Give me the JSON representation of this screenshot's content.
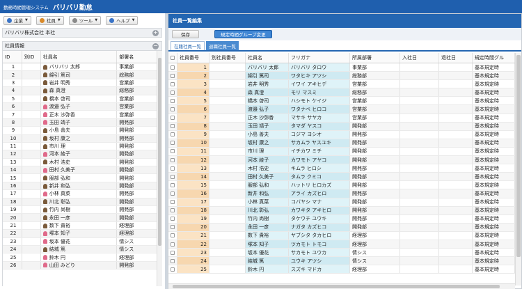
{
  "app": {
    "system_name": "勤務時間管理システム",
    "app_name": "バリバリ勤怠"
  },
  "menu": [
    {
      "label": "企業",
      "icon": "building-icon",
      "color": "#3a74c7"
    },
    {
      "label": "社員",
      "icon": "employees-icon",
      "color": "#d98a2b"
    },
    {
      "label": "ツール",
      "icon": "gear-icon",
      "color": "#8a8a8a"
    },
    {
      "label": "ヘルプ",
      "icon": "help-icon",
      "color": "#3a74c7"
    }
  ],
  "left": {
    "company": "バリバリ株式会社 本社",
    "section_title": "社員情報",
    "columns": [
      "ID",
      "別ID",
      "社員名",
      "部署名"
    ],
    "rows": [
      {
        "id": "1",
        "alt_id": "",
        "name": "バリバリ 太郎",
        "dept": "事業部",
        "g": "m"
      },
      {
        "id": "2",
        "alt_id": "",
        "name": "綿引 篤司",
        "dept": "総務部",
        "g": "m"
      },
      {
        "id": "3",
        "alt_id": "",
        "name": "岩井 明秀",
        "dept": "営業部",
        "g": "m"
      },
      {
        "id": "4",
        "alt_id": "",
        "name": "森 真澄",
        "dept": "総務部",
        "g": "m"
      },
      {
        "id": "5",
        "alt_id": "",
        "name": "橋本 啓司",
        "dept": "営業部",
        "g": "m"
      },
      {
        "id": "6",
        "alt_id": "",
        "name": "渡邉 弘子",
        "dept": "営業部",
        "g": "f"
      },
      {
        "id": "7",
        "alt_id": "",
        "name": "正木 沙弥香",
        "dept": "営業部",
        "g": "f"
      },
      {
        "id": "8",
        "alt_id": "",
        "name": "玉田 靖子",
        "dept": "開発部",
        "g": "f"
      },
      {
        "id": "9",
        "alt_id": "",
        "name": "小島 善夫",
        "dept": "開発部",
        "g": "m"
      },
      {
        "id": "10",
        "alt_id": "",
        "name": "坂村 康之",
        "dept": "開発部",
        "g": "m"
      },
      {
        "id": "11",
        "alt_id": "",
        "name": "市川 理",
        "dept": "開発部",
        "g": "m"
      },
      {
        "id": "12",
        "alt_id": "",
        "name": "河本 綾子",
        "dept": "開発部",
        "g": "f"
      },
      {
        "id": "13",
        "alt_id": "",
        "name": "木村 浩史",
        "dept": "開発部",
        "g": "m"
      },
      {
        "id": "14",
        "alt_id": "",
        "name": "田村 久美子",
        "dept": "開発部",
        "g": "f"
      },
      {
        "id": "15",
        "alt_id": "",
        "name": "服部 弘和",
        "dept": "開発部",
        "g": "m"
      },
      {
        "id": "16",
        "alt_id": "",
        "name": "新井 和弘",
        "dept": "開発部",
        "g": "m"
      },
      {
        "id": "17",
        "alt_id": "",
        "name": "小林 真菜",
        "dept": "開発部",
        "g": "f"
      },
      {
        "id": "18",
        "alt_id": "",
        "name": "川北 彰弘",
        "dept": "開発部",
        "g": "m"
      },
      {
        "id": "19",
        "alt_id": "",
        "name": "竹内 尚樹",
        "dept": "開発部",
        "g": "m"
      },
      {
        "id": "20",
        "alt_id": "",
        "name": "永田 一彦",
        "dept": "開発部",
        "g": "m"
      },
      {
        "id": "21",
        "alt_id": "",
        "name": "数下 貴裕",
        "dept": "経理部",
        "g": "m"
      },
      {
        "id": "22",
        "alt_id": "",
        "name": "塚本 知子",
        "dept": "経理部",
        "g": "f"
      },
      {
        "id": "23",
        "alt_id": "",
        "name": "坂本 優花",
        "dept": "情シス",
        "g": "f"
      },
      {
        "id": "24",
        "alt_id": "",
        "name": "結城 篤",
        "dept": "情シス",
        "g": "m"
      },
      {
        "id": "25",
        "alt_id": "",
        "name": "鈴木 円",
        "dept": "経理部",
        "g": "f"
      },
      {
        "id": "26",
        "alt_id": "",
        "name": "山田 みどり",
        "dept": "開発部",
        "g": "f"
      }
    ]
  },
  "right": {
    "title": "社員一覧編集",
    "save_label": "保存",
    "group_change_label": "規定時間グループ変更",
    "tabs": [
      "在籍社員一覧",
      "退職社員一覧"
    ],
    "columns": [
      "社員番号",
      "別社員番号",
      "社員名",
      "フリガナ",
      "所属部署",
      "入社日",
      "退社日",
      "規定時間グル"
    ],
    "rows": [
      {
        "no": "1",
        "alt": "",
        "name": "バリバリ 太郎",
        "kana": "バリバリ タロウ",
        "dept": "事業部",
        "join": "",
        "leave": "",
        "group": "基本規定時"
      },
      {
        "no": "2",
        "alt": "",
        "name": "綿引 篤司",
        "kana": "ワタヒキ アツシ",
        "dept": "総務部",
        "join": "",
        "leave": "",
        "group": "基本規定時"
      },
      {
        "no": "3",
        "alt": "",
        "name": "岩井 明秀",
        "kana": "イワイ アキヒデ",
        "dept": "営業部",
        "join": "",
        "leave": "",
        "group": "基本規定時"
      },
      {
        "no": "4",
        "alt": "",
        "name": "森 真澄",
        "kana": "モリ マスミ",
        "dept": "総務部",
        "join": "",
        "leave": "",
        "group": "基本規定時"
      },
      {
        "no": "5",
        "alt": "",
        "name": "橋本 啓司",
        "kana": "ハシモト ケイジ",
        "dept": "営業部",
        "join": "",
        "leave": "",
        "group": "基本規定時"
      },
      {
        "no": "6",
        "alt": "",
        "name": "渡邉 弘子",
        "kana": "ワタナベ ヒロコ",
        "dept": "営業部",
        "join": "",
        "leave": "",
        "group": "基本規定時"
      },
      {
        "no": "7",
        "alt": "",
        "name": "正木 沙弥香",
        "kana": "マサキ サヤカ",
        "dept": "営業部",
        "join": "",
        "leave": "",
        "group": "基本規定時"
      },
      {
        "no": "8",
        "alt": "",
        "name": "玉田 靖子",
        "kana": "タマダ ヤスコ",
        "dept": "開発部",
        "join": "",
        "leave": "",
        "group": "基本規定時"
      },
      {
        "no": "9",
        "alt": "",
        "name": "小島 善夫",
        "kana": "コジマ ヨシオ",
        "dept": "開発部",
        "join": "",
        "leave": "",
        "group": "基本規定時"
      },
      {
        "no": "10",
        "alt": "",
        "name": "坂村 康之",
        "kana": "サカムラ ヤスユキ",
        "dept": "開発部",
        "join": "",
        "leave": "",
        "group": "基本規定時"
      },
      {
        "no": "11",
        "alt": "",
        "name": "市川 理",
        "kana": "イチカワ ミチ",
        "dept": "開発部",
        "join": "",
        "leave": "",
        "group": "基本規定時"
      },
      {
        "no": "12",
        "alt": "",
        "name": "河本 綾子",
        "kana": "カワモト アヤコ",
        "dept": "開発部",
        "join": "",
        "leave": "",
        "group": "基本規定時"
      },
      {
        "no": "13",
        "alt": "",
        "name": "木村 浩史",
        "kana": "キムラ ヒロシ",
        "dept": "開発部",
        "join": "",
        "leave": "",
        "group": "基本規定時"
      },
      {
        "no": "14",
        "alt": "",
        "name": "田村 久美子",
        "kana": "タムラ クミコ",
        "dept": "開発部",
        "join": "",
        "leave": "",
        "group": "基本規定時"
      },
      {
        "no": "15",
        "alt": "",
        "name": "服部 弘和",
        "kana": "ハットリ ヒロカズ",
        "dept": "開発部",
        "join": "",
        "leave": "",
        "group": "基本規定時"
      },
      {
        "no": "16",
        "alt": "",
        "name": "新井 和弘",
        "kana": "アライ カズヒロ",
        "dept": "開発部",
        "join": "",
        "leave": "",
        "group": "基本規定時"
      },
      {
        "no": "17",
        "alt": "",
        "name": "小林 真菜",
        "kana": "コバヤシ マナ",
        "dept": "開発部",
        "join": "",
        "leave": "",
        "group": "基本規定時"
      },
      {
        "no": "18",
        "alt": "",
        "name": "川北 彰弘",
        "kana": "カワキタ アキヒロ",
        "dept": "開発部",
        "join": "",
        "leave": "",
        "group": "基本規定時"
      },
      {
        "no": "19",
        "alt": "",
        "name": "竹内 尚樹",
        "kana": "タケウチ ユウキ",
        "dept": "開発部",
        "join": "",
        "leave": "",
        "group": "基本規定時"
      },
      {
        "no": "20",
        "alt": "",
        "name": "永田 一彦",
        "kana": "ナガタ カズヒコ",
        "dept": "開発部",
        "join": "",
        "leave": "",
        "group": "基本規定時"
      },
      {
        "no": "21",
        "alt": "",
        "name": "数下 貴裕",
        "kana": "ヤブシタ タカヒロ",
        "dept": "経理部",
        "join": "",
        "leave": "",
        "group": "基本規定時"
      },
      {
        "no": "22",
        "alt": "",
        "name": "塚本 知子",
        "kana": "ツカモト トモコ",
        "dept": "経理部",
        "join": "",
        "leave": "",
        "group": "基本規定時"
      },
      {
        "no": "23",
        "alt": "",
        "name": "坂本 優花",
        "kana": "サカモト ユウカ",
        "dept": "情シス",
        "join": "",
        "leave": "",
        "group": "基本規定時"
      },
      {
        "no": "24",
        "alt": "",
        "name": "結城 篤",
        "kana": "ユウキ アツシ",
        "dept": "情シス",
        "join": "",
        "leave": "",
        "group": "基本規定時"
      },
      {
        "no": "25",
        "alt": "",
        "name": "鈴木 円",
        "kana": "スズキ マドカ",
        "dept": "経理部",
        "join": "",
        "leave": "",
        "group": "基本規定時"
      }
    ]
  }
}
